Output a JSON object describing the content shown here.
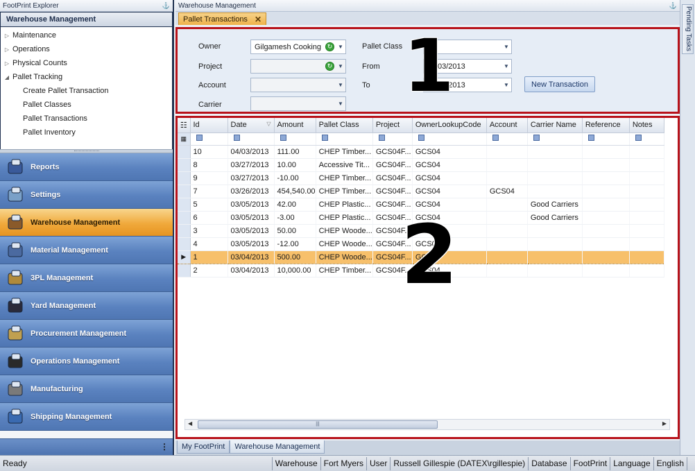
{
  "left_pane": {
    "title": "FootPrint Explorer",
    "header": "Warehouse Management",
    "tree": [
      {
        "label": "Maintenance",
        "level": 0,
        "arrow": "▷"
      },
      {
        "label": "Operations",
        "level": 0,
        "arrow": "▷"
      },
      {
        "label": "Physical Counts",
        "level": 0,
        "arrow": "▷"
      },
      {
        "label": "Pallet Tracking",
        "level": 0,
        "arrow": "◢"
      },
      {
        "label": "Create Pallet Transaction",
        "level": 1
      },
      {
        "label": "Pallet Classes",
        "level": 1
      },
      {
        "label": "Pallet Transactions",
        "level": 1
      },
      {
        "label": "Pallet Inventory",
        "level": 1
      }
    ],
    "nav": [
      {
        "label": "Reports",
        "icon": "reports-icon",
        "active": false
      },
      {
        "label": "Settings",
        "icon": "settings-icon",
        "active": false
      },
      {
        "label": "Warehouse Management",
        "icon": "warehouse-icon",
        "active": true
      },
      {
        "label": "Material Management",
        "icon": "material-icon",
        "active": false
      },
      {
        "label": "3PL Management",
        "icon": "3pl-icon",
        "active": false
      },
      {
        "label": "Yard Management",
        "icon": "yard-icon",
        "active": false
      },
      {
        "label": "Procurement Management",
        "icon": "procurement-icon",
        "active": false
      },
      {
        "label": "Operations Management",
        "icon": "operations-icon",
        "active": false
      },
      {
        "label": "Manufacturing",
        "icon": "manufacturing-icon",
        "active": false
      },
      {
        "label": "Shipping Management",
        "icon": "shipping-icon",
        "active": false
      }
    ]
  },
  "main": {
    "title": "Warehouse Management",
    "tab": "Pallet Transactions",
    "filters": {
      "owner_label": "Owner",
      "owner_value": "Gilgamesh Cooking",
      "project_label": "Project",
      "project_value": "",
      "account_label": "Account",
      "account_value": "",
      "carrier_label": "Carrier",
      "carrier_value": "",
      "pallet_class_label": "Pallet Class",
      "pallet_class_value": "",
      "from_label": "From",
      "from_value": "03/2013",
      "to_label": "To",
      "to_value": "03/2013",
      "new_transaction": "New Transaction"
    },
    "annotation_1": "1",
    "annotation_2": "2",
    "grid": {
      "columns": [
        "Id",
        "Date",
        "Amount",
        "Pallet Class",
        "Project",
        "OwnerLookupCode",
        "Account",
        "Carrier Name",
        "Reference",
        "Notes"
      ],
      "rows": [
        {
          "id": "10",
          "date": "04/03/2013",
          "amount": "111.00",
          "pallet_class": "CHEP Timber...",
          "project": "GCS04F...",
          "owner": "GCS04",
          "account": "",
          "carrier": "",
          "reference": "",
          "notes": "",
          "selected": false
        },
        {
          "id": "8",
          "date": "03/27/2013",
          "amount": "10.00",
          "pallet_class": "Accessive Tit...",
          "project": "GCS04F...",
          "owner": "GCS04",
          "account": "",
          "carrier": "",
          "reference": "",
          "notes": "",
          "selected": false
        },
        {
          "id": "9",
          "date": "03/27/2013",
          "amount": "-10.00",
          "pallet_class": "CHEP Timber...",
          "project": "GCS04F...",
          "owner": "GCS04",
          "account": "",
          "carrier": "",
          "reference": "",
          "notes": "",
          "selected": false
        },
        {
          "id": "7",
          "date": "03/26/2013",
          "amount": "454,540.00",
          "pallet_class": "CHEP Timber...",
          "project": "GCS04F...",
          "owner": "GCS04",
          "account": "GCS04",
          "carrier": "",
          "reference": "",
          "notes": "",
          "selected": false
        },
        {
          "id": "5",
          "date": "03/05/2013",
          "amount": "42.00",
          "pallet_class": "CHEP Plastic...",
          "project": "GCS04F...",
          "owner": "GCS04",
          "account": "",
          "carrier": "Good Carriers",
          "reference": "",
          "notes": "",
          "selected": false
        },
        {
          "id": "6",
          "date": "03/05/2013",
          "amount": "-3.00",
          "pallet_class": "CHEP Plastic...",
          "project": "GCS04F...",
          "owner": "GCS04",
          "account": "",
          "carrier": "Good Carriers",
          "reference": "",
          "notes": "",
          "selected": false
        },
        {
          "id": "3",
          "date": "03/05/2013",
          "amount": "50.00",
          "pallet_class": "CHEP Woode...",
          "project": "GCS04F...",
          "owner": "GCS04",
          "account": "",
          "carrier": "",
          "reference": "",
          "notes": "",
          "selected": false
        },
        {
          "id": "4",
          "date": "03/05/2013",
          "amount": "-12.00",
          "pallet_class": "CHEP Woode...",
          "project": "GCS04F...",
          "owner": "GCS04",
          "account": "",
          "carrier": "",
          "reference": "",
          "notes": "",
          "selected": false
        },
        {
          "id": "1",
          "date": "03/04/2013",
          "amount": "500.00",
          "pallet_class": "CHEP Woode...",
          "project": "GCS04F...",
          "owner": "GCS04",
          "account": "",
          "carrier": "",
          "reference": "",
          "notes": "",
          "selected": true
        },
        {
          "id": "2",
          "date": "03/04/2013",
          "amount": "10,000.00",
          "pallet_class": "CHEP Timber...",
          "project": "GCS04F...",
          "owner": "GCS04",
          "account": "",
          "carrier": "",
          "reference": "",
          "notes": "",
          "selected": false
        }
      ]
    },
    "bottom_tabs": [
      "My FootPrint",
      "Warehouse Management"
    ]
  },
  "right_rail": {
    "tab": "Pending Tasks"
  },
  "status": {
    "ready": "Ready",
    "segments": [
      "Warehouse",
      "Fort Myers",
      "User",
      "Russell Gillespie (DATEX\\rgillespie)",
      "Database",
      "FootPrint",
      "Language",
      "English"
    ]
  },
  "colors": {
    "accent_orange": "#f0a93c",
    "nav_blue": "#5a82bf",
    "highlight_red": "#b8121a",
    "selected_row": "#f7c06b"
  }
}
